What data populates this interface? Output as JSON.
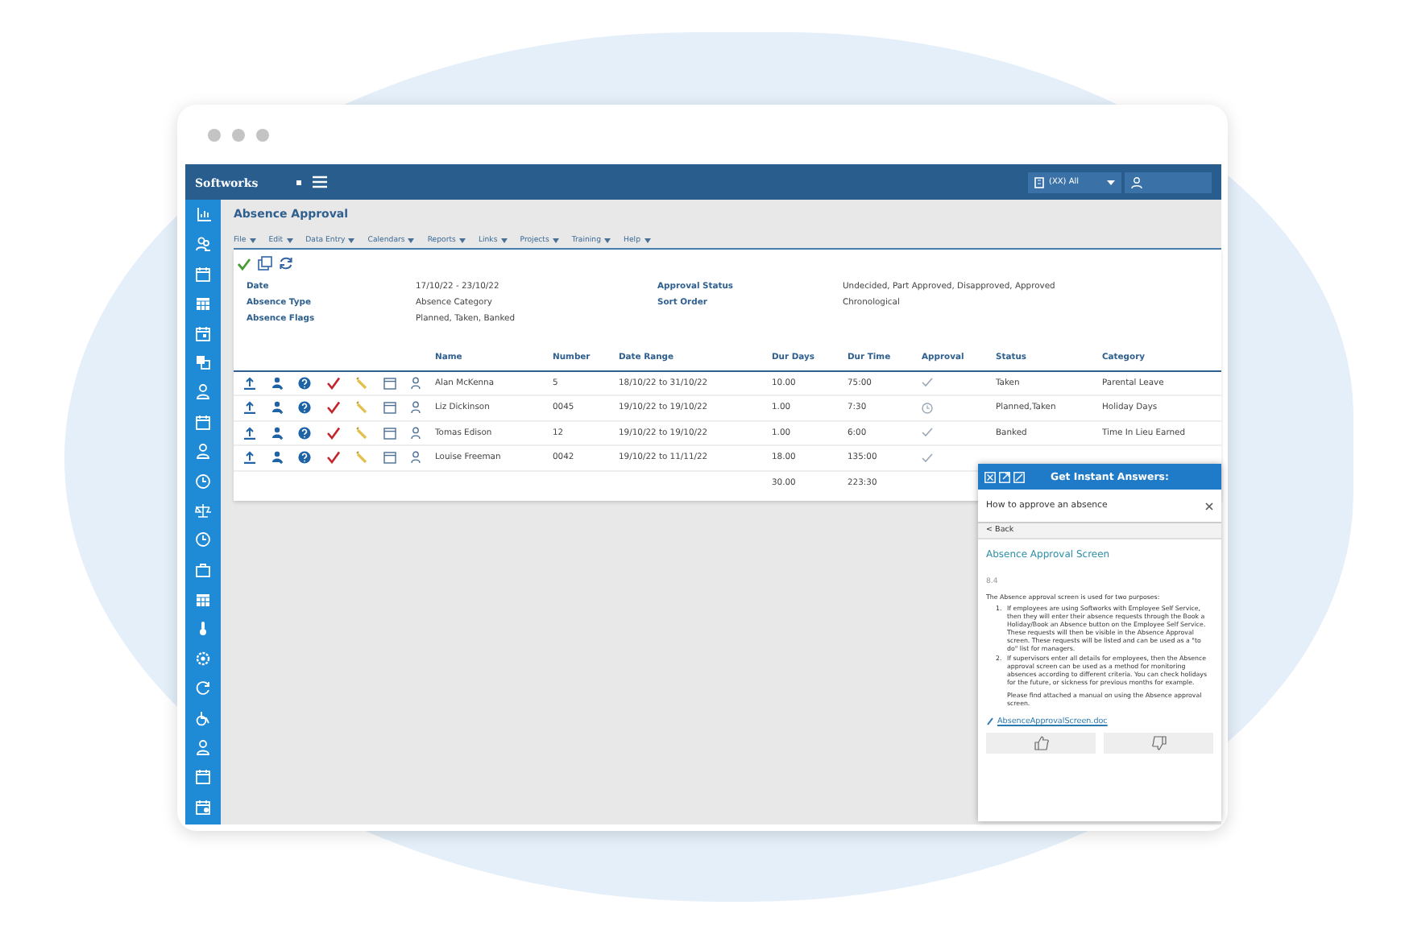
{
  "header": {
    "logo": "Softworks",
    "selector": "(XX) All"
  },
  "page": {
    "title": "Absence Approval"
  },
  "menu": [
    {
      "label": "File"
    },
    {
      "label": "Edit"
    },
    {
      "label": "Data Entry"
    },
    {
      "label": "Calendars"
    },
    {
      "label": "Reports"
    },
    {
      "label": "Links"
    },
    {
      "label": "Projects"
    },
    {
      "label": "Training"
    },
    {
      "label": "Help"
    }
  ],
  "filters": [
    {
      "label": "Date",
      "value": "17/10/22 - 23/10/22"
    },
    {
      "label": "Approval Status",
      "value": "Undecided, Part Approved, Disapproved, Approved"
    },
    {
      "label": "Absence Type",
      "value": "Absence Category"
    },
    {
      "label": "Sort Order",
      "value": "Chronological"
    },
    {
      "label": "Absence Flags",
      "value": "Planned, Taken, Banked"
    }
  ],
  "table": {
    "columns": [
      "Name",
      "Number",
      "Date Range",
      "Dur Days",
      "Dur Time",
      "Approval",
      "Status",
      "Category"
    ],
    "rows": [
      {
        "name": "Alan McKenna",
        "number": "5",
        "date_range": "18/10/22 to 31/10/22",
        "dur_days": "10.00",
        "dur_time": "75:00",
        "approved": true,
        "status": "Taken",
        "category": "Parental Leave"
      },
      {
        "name": "Liz Dickinson",
        "number": "0045",
        "date_range": "19/10/22 to 19/10/22",
        "dur_days": "1.00",
        "dur_time": "7:30",
        "approved": false,
        "status": "Planned,Taken",
        "category": "Holiday Days"
      },
      {
        "name": "Tomas Edison",
        "number": "12",
        "date_range": "19/10/22 to 19/10/22",
        "dur_days": "1.00",
        "dur_time": "6:00",
        "approved": true,
        "status": "Banked",
        "category": "Time In Lieu Earned"
      },
      {
        "name": "Louise Freeman",
        "number": "0042",
        "date_range": "19/10/22 to 11/11/22",
        "dur_days": "18.00",
        "dur_time": "135:00",
        "approved": true
      }
    ],
    "totals": {
      "dur_days": "30.00",
      "dur_time": "223:30"
    }
  },
  "help_panel": {
    "title": "Get Instant Answers:",
    "question": "How to approve an absence",
    "back": "< Back",
    "heading": "Absence Approval Screen",
    "version": "8.4",
    "intro": "The Absence approval screen is used for two purposes:",
    "points": [
      {
        "marker": "1.",
        "text": "If employees are using Softworks with Employee Self Service, then they will enter their absence requests through the Book a Holiday/Book an Absence button on the Employee Self Service. These requests will then be visible in the Absence Approval screen. These requests will be listed and can be used as a \"to do\" list for managers."
      },
      {
        "marker": "2.",
        "text": "If supervisors enter all details for employees, then the Absence approval screen can be used as a method for monitoring absences according to different criteria. You can check holidays for the future, or sickness for previous months for example."
      }
    ],
    "note": "Please find attached a manual on using the Absence approval screen.",
    "attachment": "AbsenceApprovalScreen.doc"
  }
}
